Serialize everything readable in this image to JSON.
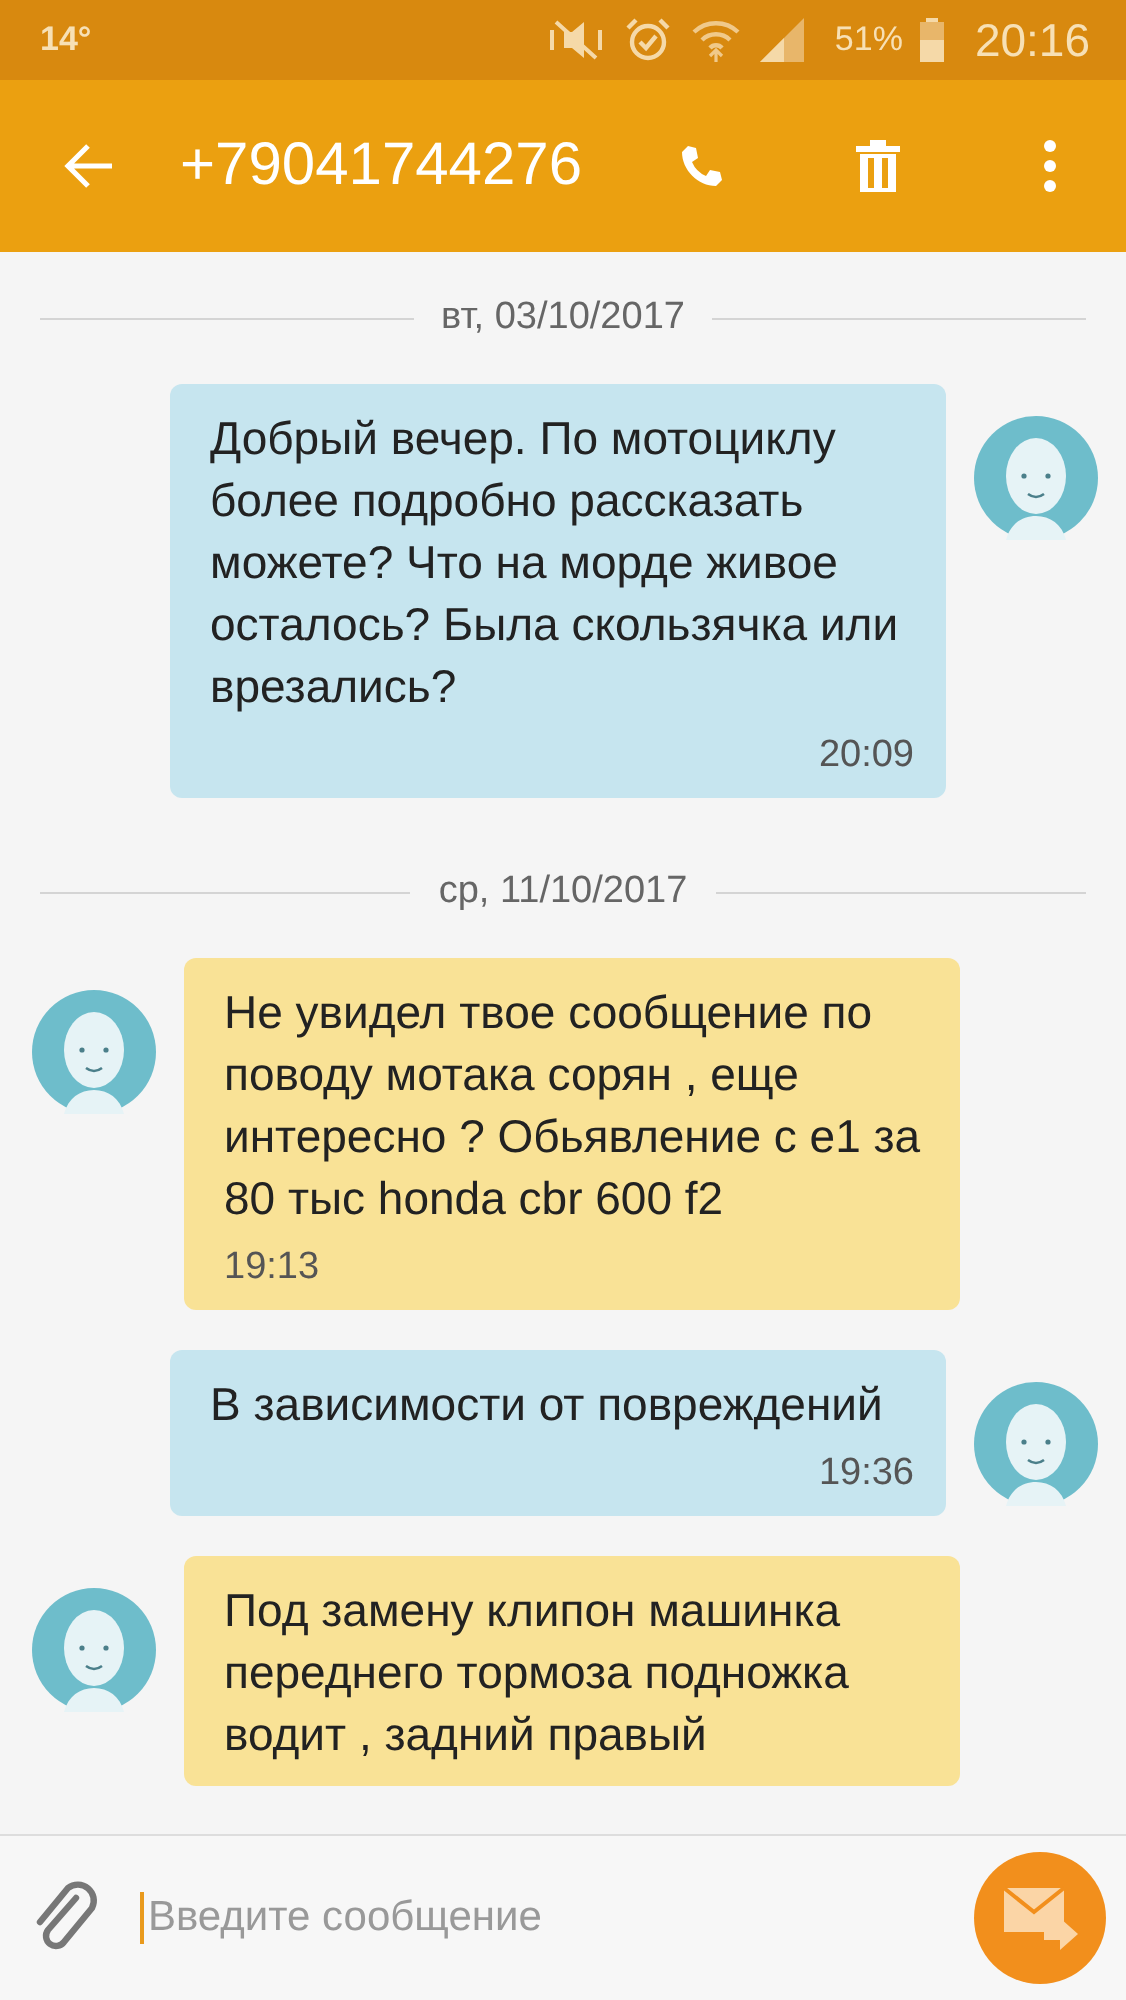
{
  "status_bar": {
    "temperature": "14°",
    "battery": "51%",
    "time": "20:16"
  },
  "header": {
    "title": "+79041744276"
  },
  "items": [
    {
      "kind": "date",
      "text": "вт, 03/10/2017"
    },
    {
      "kind": "sent",
      "text": "Добрый вечер. По мотоциклу более подробно рассказать можете? Что на морде живое осталось? Была скользячка или врезались?",
      "time": "20:09"
    },
    {
      "kind": "date",
      "text": "ср, 11/10/2017"
    },
    {
      "kind": "received",
      "text": "Не увидел твое сообщение по поводу мотака сорян , еще интересно ? Обьявление с е1 за 80 тыс honda cbr 600 f2",
      "time": "19:13"
    },
    {
      "kind": "sent",
      "text": "В зависимости от повреждений",
      "time": "19:36"
    },
    {
      "kind": "received",
      "text": "Под замену клипон машинка переднего тормоза подножка водит , задний правый"
    }
  ],
  "composer": {
    "placeholder": "Введите сообщение"
  }
}
